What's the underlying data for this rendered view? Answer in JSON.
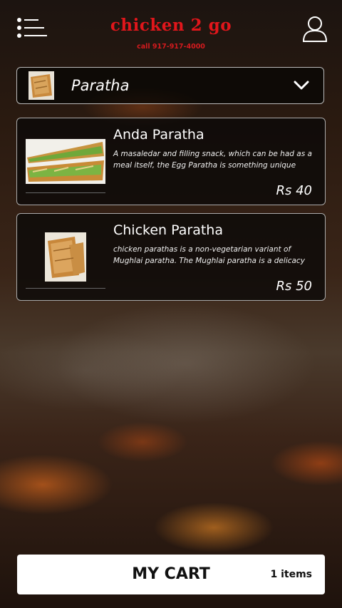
{
  "header": {
    "brand": "chicken 2 go",
    "phone": "call 917-917-4000",
    "menu_icon": "hamburger-list-icon",
    "user_icon": "user-profile-icon"
  },
  "category_selector": {
    "selected": "Paratha",
    "icon": "chevron-down-icon"
  },
  "items": [
    {
      "name": "Anda Paratha",
      "description": " A masaledar and filling snack, which can be had as a meal itself, the Egg Paratha is something unique",
      "price": "Rs 40"
    },
    {
      "name": "Chicken Paratha",
      "description": "chicken parathas is a non-vegetarian variant of Mughlai paratha. The Mughlai paratha is a delicacy",
      "price": "Rs 50"
    }
  ],
  "cart": {
    "label": "MY CART",
    "count": "1 items"
  },
  "colors": {
    "brand_red": "#e0161b",
    "card_bg": "#0c0a08",
    "cart_bg": "#ffffff"
  }
}
